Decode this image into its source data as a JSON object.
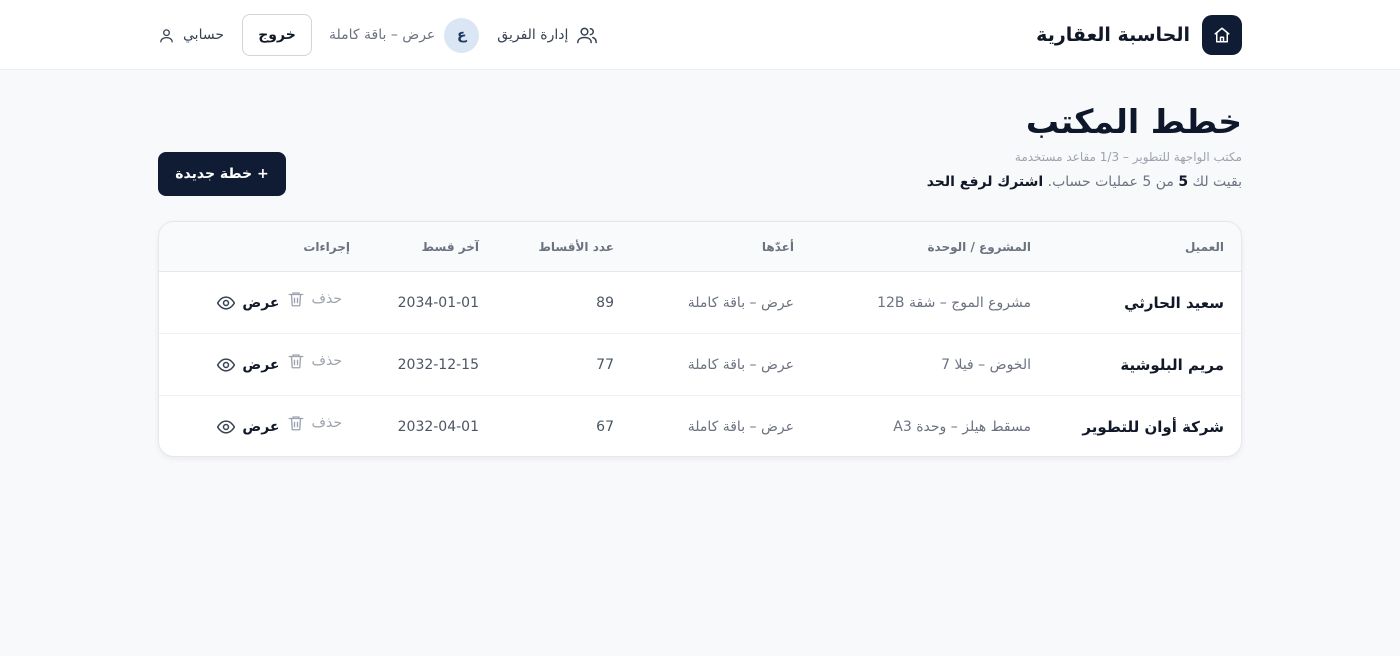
{
  "header": {
    "brand": "الحاسبة العقارية",
    "team_link": "إدارة الفريق",
    "avatar_initial": "ع",
    "plan_label": "عرض – باقة كاملة",
    "logout_label": "خروج",
    "account_label": "حسابي"
  },
  "page": {
    "title": "خطط المكتب",
    "subtitle": "مكتب الواجهة للتطوير – 1/3 مقاعد مستخدمة",
    "quota_prefix": "بقيت لك ",
    "quota_count": "5",
    "quota_middle": " من 5 عمليات حساب. ",
    "quota_link": "اشترك لرفع الحد",
    "new_plan_label": "+ خطة جديدة"
  },
  "table": {
    "columns": {
      "client": "العميل",
      "project": "المشروع / الوحدة",
      "author": "أعدّها",
      "count": "عدد الأقساط",
      "last": "آخر قسط",
      "actions": "إجراءات"
    },
    "view_label": "عرض",
    "delete_label": "حذف",
    "rows": [
      {
        "client": "سعيد الحارثي",
        "project": "مشروع الموج – شقة 12B",
        "author": "عرض – باقة كاملة",
        "count": "89",
        "last": "2034-01-01"
      },
      {
        "client": "مريم البلوشية",
        "project": "الخوض – فيلا 7",
        "author": "عرض – باقة كاملة",
        "count": "77",
        "last": "2032-12-15"
      },
      {
        "client": "شركة أوان للتطوير",
        "project": "مسقط هيلز – وحدة A3",
        "author": "عرض – باقة كاملة",
        "count": "67",
        "last": "2032-04-01"
      }
    ]
  },
  "colors": {
    "primary": "#0f1c33",
    "background": "#f8f9fb",
    "avatar_bg": "#dbe6f5"
  },
  "icons": [
    "home-icon",
    "users-icon",
    "user-icon",
    "eye-icon",
    "trash-icon"
  ]
}
